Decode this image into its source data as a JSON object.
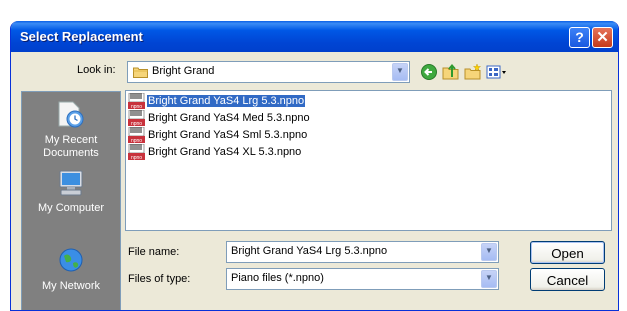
{
  "window": {
    "title": "Select Replacement"
  },
  "title_buttons": {
    "help": "?",
    "close": "✕"
  },
  "lookin": {
    "label": "Look in:",
    "value": "Bright Grand",
    "folder_icon": "folder-icon"
  },
  "toolbar": {
    "icons": [
      "back-icon",
      "up-folder-icon",
      "new-folder-icon",
      "view-menu-icon"
    ]
  },
  "places": [
    {
      "label": "My Recent Documents",
      "icon": "recent-documents-icon"
    },
    {
      "label": "My Computer",
      "icon": "my-computer-icon"
    },
    {
      "label": "My Network",
      "icon": "network-icon"
    }
  ],
  "files": [
    {
      "name": "Bright Grand YaS4  Lrg 5.3.npno",
      "selected": true
    },
    {
      "name": "Bright Grand YaS4  Med 5.3.npno",
      "selected": false
    },
    {
      "name": "Bright Grand YaS4  Sml 5.3.npno",
      "selected": false
    },
    {
      "name": "Bright Grand YaS4  XL 5.3.npno",
      "selected": false
    }
  ],
  "file_name": {
    "label": "File name:",
    "value": "Bright Grand YaS4  Lrg 5.3.npno"
  },
  "file_type": {
    "label": "Files of type:",
    "value": "Piano files (*.npno)"
  },
  "buttons": {
    "open": "Open",
    "cancel": "Cancel"
  },
  "colors": {
    "titlebar": "#0054e3",
    "selection": "#316ac5",
    "dialog_bg": "#ece9d8",
    "places_bg": "#808080"
  }
}
